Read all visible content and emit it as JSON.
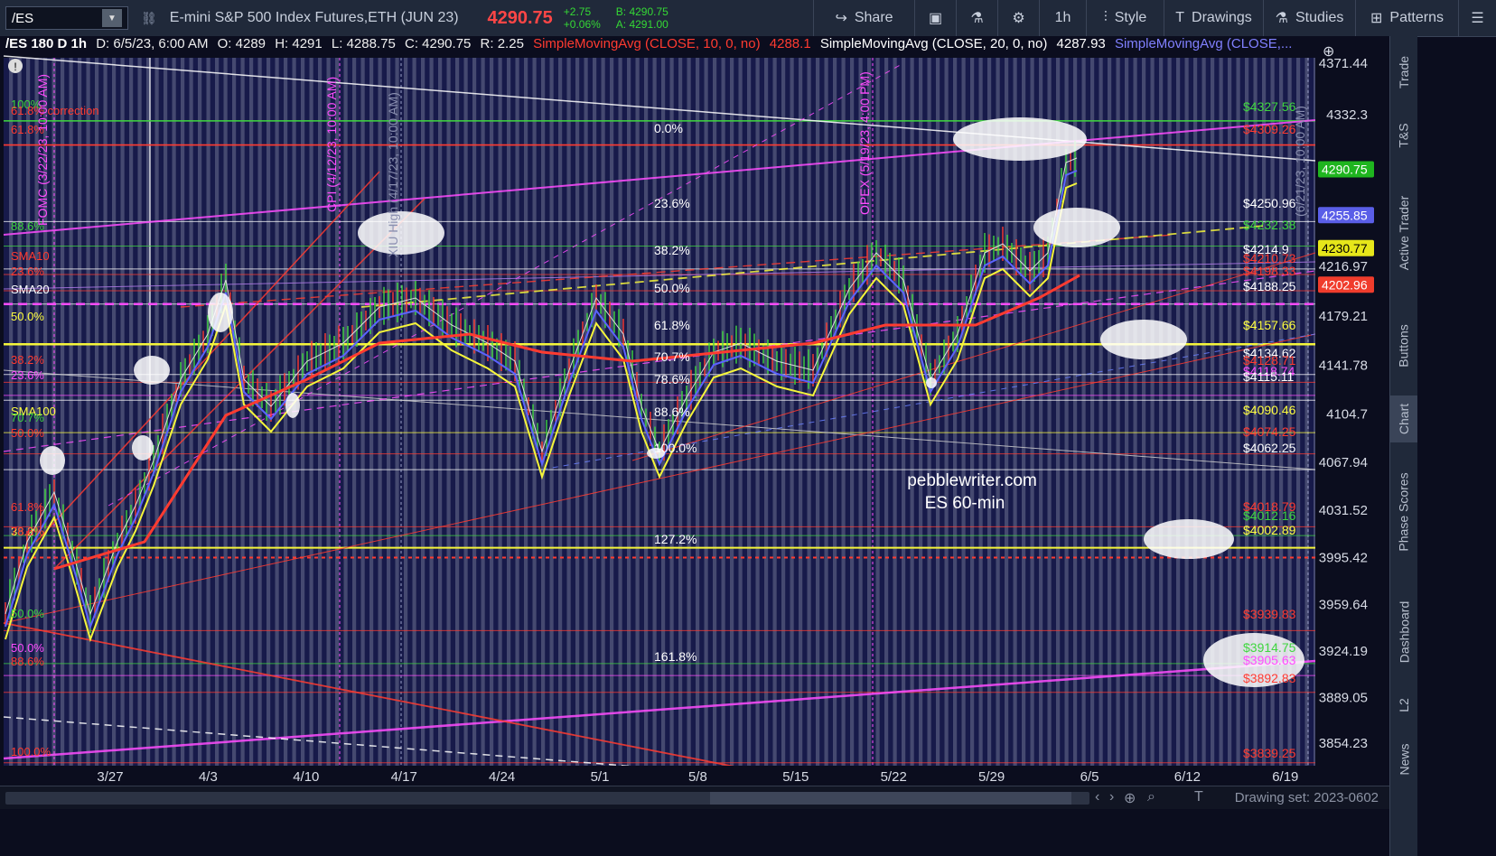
{
  "toolbar": {
    "symbol": "/ES",
    "link_icon": "link-icon",
    "instrument_name": "E-mini S&P 500 Index Futures,ETH (JUN 23)",
    "last_price": "4290.75",
    "change": "+2.75",
    "change_pct": "+0.06%",
    "bid": "B: 4290.75",
    "ask": "A: 4291.00",
    "share_label": "Share",
    "interval_label": "1h",
    "style_label": "Style",
    "drawings_label": "Drawings",
    "studies_label": "Studies",
    "patterns_label": "Patterns"
  },
  "info": {
    "title": "/ES 180 D 1h",
    "date": "D: 6/5/23, 6:00 AM",
    "open": "O: 4289",
    "high": "H: 4291",
    "low": "L: 4288.75",
    "close": "C: 4290.75",
    "range": "R: 2.25",
    "sma10_label": "SimpleMovingAvg (CLOSE, 10, 0, no)",
    "sma10_value": "4288.1",
    "sma20_label": "SimpleMovingAvg (CLOSE, 20, 0, no)",
    "sma20_value": "4287.93",
    "sma_more_label": "SimpleMovingAvg (CLOSE,..."
  },
  "colors": {
    "background": "#171a4a",
    "stripe": "#555a7d",
    "red": "#ff3b30",
    "magenta": "#ff4cff",
    "yellow": "#f5f53a",
    "green": "#3fd63f",
    "blue": "#5b63ff",
    "white": "#ffffff"
  },
  "y_axis": [
    "4371.44",
    "4332.3",
    "4290.75",
    "4255.85",
    "4230.77",
    "4216.97",
    "4202.96",
    "4179.21",
    "4141.78",
    "4104.7",
    "4067.94",
    "4031.52",
    "3995.42",
    "3959.64",
    "3924.19",
    "3889.05",
    "3854.23"
  ],
  "y_badges": [
    {
      "value": "4290.75",
      "color": "#1fb51f"
    },
    {
      "value": "4255.85",
      "color": "#5a5ee8"
    },
    {
      "value": "4230.77",
      "color": "#e6e61a"
    },
    {
      "value": "4202.96",
      "color": "#f03c2c"
    }
  ],
  "x_axis": [
    "3/27",
    "4/3",
    "4/10",
    "4/17",
    "4/24",
    "5/1",
    "5/8",
    "5/15",
    "5/22",
    "5/29",
    "6/5",
    "6/12",
    "6/19"
  ],
  "left_labels": [
    {
      "text": "100%",
      "color": "#3fd63f"
    },
    {
      "text": "61.8% correction",
      "color": "#ff3b30"
    },
    {
      "text": "61.8%",
      "color": "#ff3b30"
    },
    {
      "text": "88.6%",
      "color": "#3fd63f"
    },
    {
      "text": "SMA10",
      "color": "#ff3b30"
    },
    {
      "text": "23.6%",
      "color": "#ff3b30"
    },
    {
      "text": "SMA20",
      "color": "#ffffff"
    },
    {
      "text": "50.0%",
      "color": "#ffff40"
    },
    {
      "text": "38.2%",
      "color": "#ff3b30"
    },
    {
      "text": "23.6%",
      "color": "#ff4cff"
    },
    {
      "text": "SMA100",
      "color": "#ffff40"
    },
    {
      "text": "70.7%",
      "color": "#3fd63f"
    },
    {
      "text": "50.0%",
      "color": "#ff3b30"
    },
    {
      "text": "61.8%",
      "color": "#ff3b30"
    },
    {
      "text": "38.2%",
      "color": "#ffff40"
    },
    {
      "text": "78.6%",
      "color": "#ff3b30"
    },
    {
      "text": "50.0%",
      "color": "#3fd63f"
    },
    {
      "text": "50.0%",
      "color": "#ff4cff"
    },
    {
      "text": "88.6%",
      "color": "#ff3b30"
    },
    {
      "text": "100.0%",
      "color": "#ff3b30"
    }
  ],
  "fib_labels": [
    "0.0%",
    "23.6%",
    "38.2%",
    "50.0%",
    "61.8%",
    "70.7%",
    "78.6%",
    "88.6%",
    "100.0%",
    "127.2%",
    "161.8%"
  ],
  "right_labels": [
    {
      "text": "$4327.56",
      "color": "#3fd63f"
    },
    {
      "text": "$4309.26",
      "color": "#ff3b30"
    },
    {
      "text": "$4250.96",
      "color": "#ffffff"
    },
    {
      "text": "$4232.38",
      "color": "#3fd63f"
    },
    {
      "text": "$4214.9",
      "color": "#ffffff"
    },
    {
      "text": "$4210.73",
      "color": "#ff3b30"
    },
    {
      "text": "$4198.33",
      "color": "#ff3b30"
    },
    {
      "text": "$4188.25",
      "color": "#ffffff"
    },
    {
      "text": "$4157.66",
      "color": "#ffff40"
    },
    {
      "text": "$4134.62",
      "color": "#ffffff"
    },
    {
      "text": "$4128.71",
      "color": "#ff3b30"
    },
    {
      "text": "$4118.74",
      "color": "#ff4cff"
    },
    {
      "text": "$4115.11",
      "color": "#ffffff"
    },
    {
      "text": "$4090.46",
      "color": "#ffff40"
    },
    {
      "text": "$4074.25",
      "color": "#ff3b30"
    },
    {
      "text": "$4062.25",
      "color": "#ffffff"
    },
    {
      "text": "$4018.79",
      "color": "#ff3b30"
    },
    {
      "text": "$4012.16",
      "color": "#3fd63f"
    },
    {
      "text": "$4002.89",
      "color": "#ffff40"
    },
    {
      "text": "$3939.83",
      "color": "#ff3b30"
    },
    {
      "text": "$3914.75",
      "color": "#3fd63f"
    },
    {
      "text": "$3905.63",
      "color": "#ff4cff"
    },
    {
      "text": "$3892.83",
      "color": "#ff3b30"
    },
    {
      "text": "$3839.25",
      "color": "#ff3b30"
    }
  ],
  "event_labels": [
    {
      "text": "FOMC (3/22/23, 10:00 AM)",
      "color": "#ff4cff"
    },
    {
      "text": "CPI (4/12/23, 10:00 AM)",
      "color": "#ff4cff"
    },
    {
      "text": "XIU High (4/17/23, 10:00 AM)",
      "color": "#8a8fb0"
    },
    {
      "text": "OPEX (5/19/23, 4:00 PM)",
      "color": "#ff4cff"
    },
    {
      "text": "(6/21/23, 10:00 AM)",
      "color": "#8a8fb0"
    }
  ],
  "watermark": [
    "pebblewriter.com",
    "ES 60-min"
  ],
  "right_tabs": [
    "Trade",
    "T&S",
    "Active Trader",
    "Buttons",
    "Chart",
    "Phase Scores",
    "Dashboard",
    "L2",
    "News"
  ],
  "bottom": {
    "drawing_set": "Drawing set: 2023-0602"
  }
}
